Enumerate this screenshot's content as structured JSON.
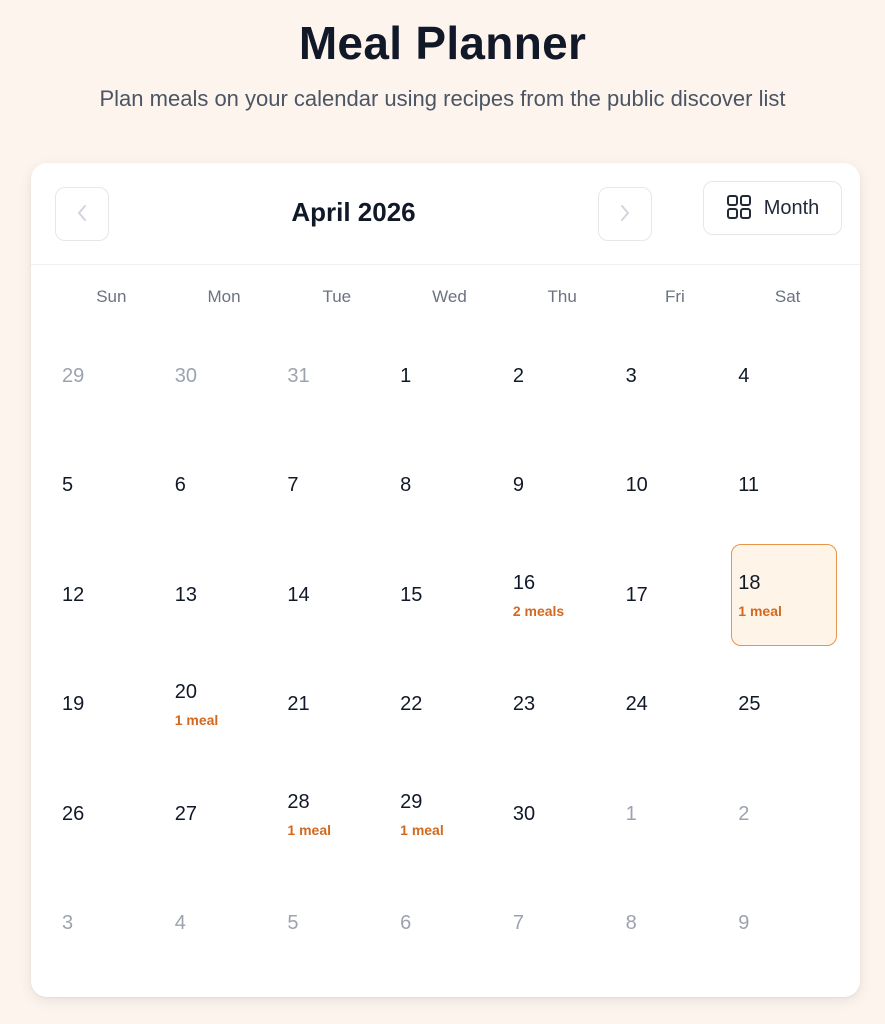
{
  "header": {
    "title": "Meal Planner",
    "subtitle": "Plan meals on your calendar using recipes from the public discover list"
  },
  "calendar": {
    "month_label": "April 2026",
    "view_label": "Month",
    "weekdays": [
      "Sun",
      "Mon",
      "Tue",
      "Wed",
      "Thu",
      "Fri",
      "Sat"
    ],
    "weeks": [
      [
        {
          "day": "29",
          "muted": true
        },
        {
          "day": "30",
          "muted": true
        },
        {
          "day": "31",
          "muted": true
        },
        {
          "day": "1"
        },
        {
          "day": "2"
        },
        {
          "day": "3"
        },
        {
          "day": "4"
        }
      ],
      [
        {
          "day": "5"
        },
        {
          "day": "6"
        },
        {
          "day": "7"
        },
        {
          "day": "8"
        },
        {
          "day": "9"
        },
        {
          "day": "10"
        },
        {
          "day": "11"
        }
      ],
      [
        {
          "day": "12"
        },
        {
          "day": "13"
        },
        {
          "day": "14"
        },
        {
          "day": "15"
        },
        {
          "day": "16",
          "meals": "2 meals"
        },
        {
          "day": "17"
        },
        {
          "day": "18",
          "meals": "1 meal",
          "selected": true
        }
      ],
      [
        {
          "day": "19"
        },
        {
          "day": "20",
          "meals": "1 meal"
        },
        {
          "day": "21"
        },
        {
          "day": "22"
        },
        {
          "day": "23"
        },
        {
          "day": "24"
        },
        {
          "day": "25"
        }
      ],
      [
        {
          "day": "26"
        },
        {
          "day": "27"
        },
        {
          "day": "28",
          "meals": "1 meal"
        },
        {
          "day": "29",
          "meals": "1 meal"
        },
        {
          "day": "30"
        },
        {
          "day": "1",
          "muted": true
        },
        {
          "day": "2",
          "muted": true
        }
      ],
      [
        {
          "day": "3",
          "muted": true
        },
        {
          "day": "4",
          "muted": true
        },
        {
          "day": "5",
          "muted": true
        },
        {
          "day": "6",
          "muted": true
        },
        {
          "day": "7",
          "muted": true
        },
        {
          "day": "8",
          "muted": true
        },
        {
          "day": "9",
          "muted": true
        }
      ]
    ]
  },
  "icons": {
    "prev": "chevron-left-icon",
    "next": "chevron-right-icon",
    "view": "grid-icon"
  },
  "colors": {
    "accent": "#d2691e",
    "selected_bg": "#fff4e8",
    "selected_border": "#e8954a",
    "page_bg": "#fdf4ee"
  }
}
